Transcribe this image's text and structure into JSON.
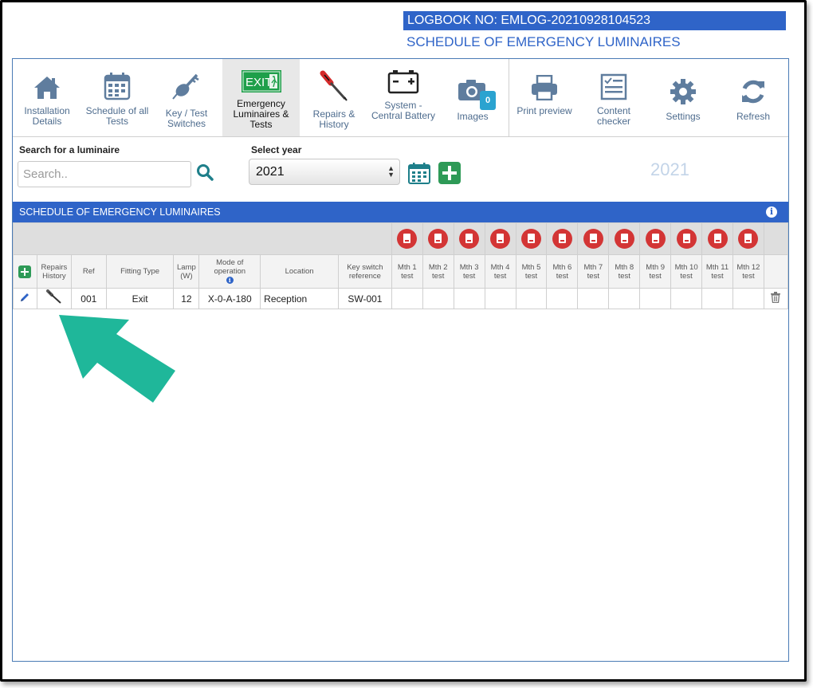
{
  "header": {
    "logbook": "LOGBOOK NO: EMLOG-20210928104523",
    "subtitle": "SCHEDULE OF EMERGENCY LUMINAIRES"
  },
  "toolbar": {
    "items": [
      {
        "label": "Installation Details",
        "icon": "house-icon"
      },
      {
        "label": "Schedule of all Tests",
        "icon": "calendar-icon"
      },
      {
        "label": "Key / Test Switches",
        "icon": "key-switch-icon"
      },
      {
        "label": "Emergency Luminaires & Tests",
        "icon": "exit-sign-icon",
        "icon_text": "EXIT",
        "active": true
      },
      {
        "label": "Repairs & History",
        "icon": "screwdriver-icon"
      },
      {
        "label": "System - Central Battery",
        "icon": "battery-icon"
      },
      {
        "label": "Images",
        "icon": "camera-icon",
        "badge": "0"
      },
      {
        "label": "Print preview",
        "icon": "printer-icon"
      },
      {
        "label": "Content checker",
        "icon": "checklist-icon"
      },
      {
        "label": "Settings",
        "icon": "gear-icon"
      },
      {
        "label": "Refresh",
        "icon": "refresh-icon"
      }
    ]
  },
  "search": {
    "label": "Search for a luminaire",
    "placeholder": "Search..",
    "value": ""
  },
  "year": {
    "label": "Select year",
    "selected": "2021",
    "display": "2021"
  },
  "schedule": {
    "title": "SCHEDULE OF EMERGENCY LUMINAIRES",
    "columns": {
      "repairs": "Repairs History",
      "ref": "Ref",
      "fitting": "Fitting Type",
      "lamp": "Lamp (W)",
      "mode": "Mode of operation",
      "location": "Location",
      "key_switch": "Key switch reference",
      "months": [
        "Mth 1 test",
        "Mth 2 test",
        "Mth 3 test",
        "Mth 4 test",
        "Mth 5 test",
        "Mth 6 test",
        "Mth 7 test",
        "Mth 8 test",
        "Mth 9 test",
        "Mth 10 test",
        "Mth 11 test",
        "Mth 12 test"
      ]
    },
    "rows": [
      {
        "ref": "001",
        "fitting": "Exit",
        "lamp": "12",
        "mode": "X-0-A-180",
        "location": "Reception",
        "key_switch": "SW-001"
      }
    ]
  },
  "colors": {
    "brand_blue": "#2f64c8",
    "toolbar_icon": "#4e6c8e",
    "add_green": "#2e9a57",
    "pdf_red": "#d33535",
    "arrow_teal": "#1fb79a"
  }
}
